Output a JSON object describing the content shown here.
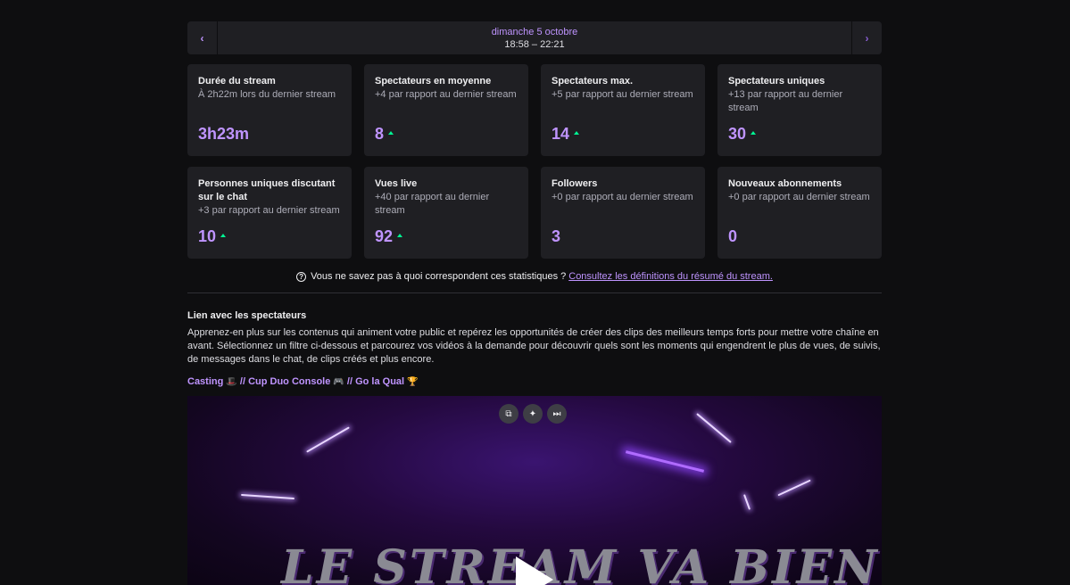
{
  "date_nav": {
    "prev_label": "‹",
    "next_label": "›",
    "day": "dimanche 5 octobre",
    "time_range": "18:58 – 22:21"
  },
  "stats": [
    {
      "title": "Durée du stream",
      "subtitle": "À 2h22m lors du dernier stream",
      "value": "3h23m",
      "trend_up": false
    },
    {
      "title": "Spectateurs en moyenne",
      "subtitle": "+4 par rapport au dernier stream",
      "value": "8",
      "trend_up": true
    },
    {
      "title": "Spectateurs max.",
      "subtitle": "+5 par rapport au dernier stream",
      "value": "14",
      "trend_up": true
    },
    {
      "title": "Spectateurs uniques",
      "subtitle": "+13 par rapport au dernier stream",
      "value": "30",
      "trend_up": true
    },
    {
      "title": "Personnes uniques discutant sur le chat",
      "subtitle": "+3 par rapport au dernier stream",
      "value": "10",
      "trend_up": true
    },
    {
      "title": "Vues live",
      "subtitle": "+40 par rapport au dernier stream",
      "value": "92",
      "trend_up": true
    },
    {
      "title": "Followers",
      "subtitle": "+0 par rapport au dernier stream",
      "value": "3",
      "trend_up": false
    },
    {
      "title": "Nouveaux abonnements",
      "subtitle": "+0 par rapport au dernier stream",
      "value": "0",
      "trend_up": false
    }
  ],
  "help": {
    "icon": "question-circle-icon",
    "text": "Vous ne savez pas à quoi correspondent ces statistiques ?",
    "link": "Consultez les définitions du résumé du stream."
  },
  "viewer_link": {
    "title": "Lien avec les spectateurs",
    "description": "Apprenez-en plus sur les contenus qui animent votre public et repérez les opportunités de créer des clips des meilleurs temps forts pour mettre votre chaîne en avant. Sélectionnez un filtre ci-dessous et parcourez vos vidéos à la demande pour découvrir quels sont les moments qui engendrent le plus de vues, de suivis, de messages dans le chat, de clips créés et plus encore."
  },
  "video": {
    "title_part1": "Casting",
    "emoji1": "🎩",
    "title_part2": " // Cup Duo Console ",
    "emoji2": "🎮",
    "title_part3": " // Go la Qual ",
    "emoji3": "🏆",
    "banner_text": "LE STREAM VA BIENTOT",
    "controls": [
      "clip-icon",
      "sparkle-icon",
      "skip-icon"
    ]
  },
  "colors": {
    "accent": "#bf94ff",
    "trend_up": "#00f593",
    "card_bg": "#1f1f23",
    "page_bg": "#0e0e10"
  }
}
